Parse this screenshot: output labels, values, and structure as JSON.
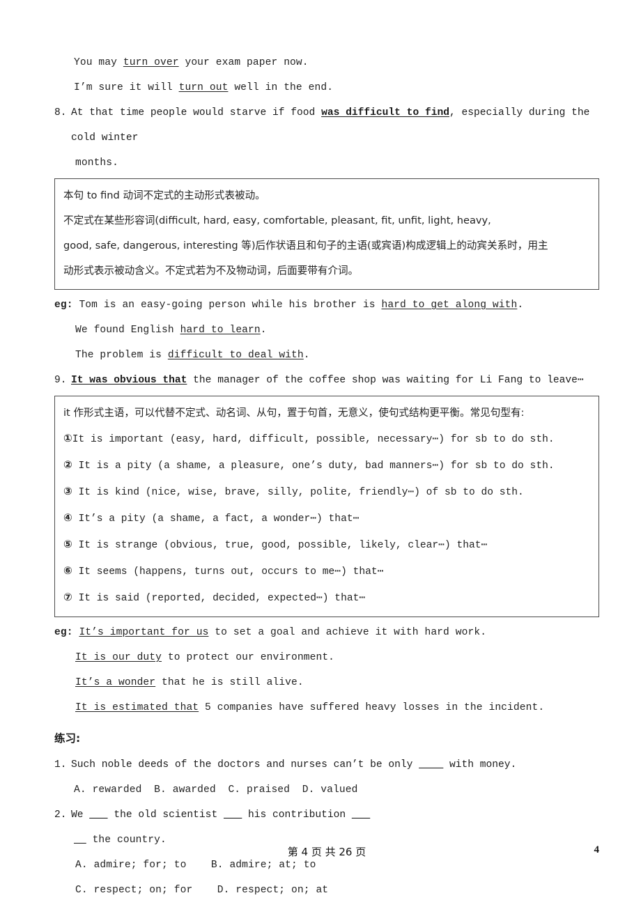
{
  "document": {
    "language": "zh-CN + en",
    "footer": {
      "center": "第 4 页 共 26 页",
      "page_number": "4"
    }
  },
  "content": {
    "example_lines_top": [
      {
        "pre": "You may ",
        "underlined": "turn over",
        "post": " your exam paper now."
      },
      {
        "pre": "I’m sure it will ",
        "underlined": "turn out",
        "post": " well in the end."
      }
    ],
    "item8": {
      "number": "8.",
      "text_before": "At that time people would starve if food ",
      "bold_underlined": "was difficult to find",
      "text_after": ", especially during the cold winter",
      "continuation": "months."
    },
    "box1": {
      "lines": [
        "本句 to find 动词不定式的主动形式表被动。",
        "不定式在某些形容词(difficult, hard, easy, comfortable, pleasant, fit, unfit, light, heavy,",
        "good, safe, dangerous, interesting 等)后作状语且和句子的主语(或宾语)构成逻辑上的动宾关系时，用主",
        "动形式表示被动含义。不定式若为不及物动词，后面要带有介词。"
      ]
    },
    "eg_block1": {
      "label": "eg:",
      "lines": [
        {
          "pre": "Tom is an easy-going person while his brother is ",
          "underlined": "hard to get along with",
          "post": "."
        },
        {
          "pre": "We found English ",
          "underlined": "hard to learn",
          "post": "."
        },
        {
          "pre": "The problem is ",
          "underlined": "difficult to deal with",
          "post": "."
        }
      ]
    },
    "item9": {
      "number": "9.",
      "bold_underlined": "It was obvious that",
      "text_after": " the manager of the coffee shop was waiting for Li Fang to leave⋯"
    },
    "box2": {
      "intro": "it 作形式主语，可以代替不定式、动名词、从句，置于句首，无意义，使句式结构更平衡。常见句型有:",
      "patterns": [
        {
          "marker": "①",
          "text": "It is important (easy, hard, difficult, possible, necessary⋯) for sb to do sth."
        },
        {
          "marker": "②",
          "text": " It is a pity (a shame, a pleasure, one’s duty, bad manners⋯) for sb to do sth."
        },
        {
          "marker": "③",
          "text": " It is kind (nice, wise, brave, silly, polite, friendly⋯) of sb to do sth."
        },
        {
          "marker": "④",
          "text": " It’s a pity (a shame, a fact, a wonder⋯) that⋯"
        },
        {
          "marker": "⑤",
          "text": " It is strange (obvious, true, good, possible, likely, clear⋯) that⋯"
        },
        {
          "marker": "⑥",
          "text": " It seems (happens, turns out, occurs to me⋯) that⋯"
        },
        {
          "marker": "⑦",
          "text": " It is said (reported, decided, expected⋯) that⋯"
        }
      ]
    },
    "eg_block2": {
      "label": "eg:",
      "lines": [
        {
          "underlined": "It’s important for us",
          "post": " to set a goal and achieve it with hard work."
        },
        {
          "underlined": "It is our duty",
          "post": " to protect our environment."
        },
        {
          "underlined": "It’s a wonder",
          "post": " that he is still alive."
        },
        {
          "underlined": "It is estimated that",
          "post": " 5 companies have suffered heavy losses in the incident."
        }
      ]
    },
    "exercises": {
      "title": "练习:",
      "questions": [
        {
          "number": "1.",
          "stem_before": "Such noble deeds of the doctors and nurses can’t be only ",
          "blank": "____",
          "stem_after": " with money.",
          "options": "A. rewarded  B. awarded  C. praised  D. valued"
        },
        {
          "number": "2.",
          "stem_part1": "We ",
          "blank1": "___",
          "stem_part2": " the old scientist ",
          "blank2": "___",
          "stem_part3": " his contribution ",
          "blank3": "___",
          "continuation_blank": "__",
          "continuation_text": " the country.",
          "options_line1": "A. admire; for; to    B. admire; at; to",
          "options_line2": "C. respect; on; for    D. respect; on; at"
        }
      ]
    }
  }
}
